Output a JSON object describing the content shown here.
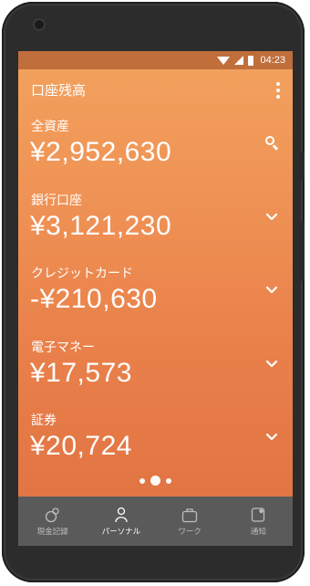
{
  "status_bar": {
    "time": "04:23"
  },
  "app_bar": {
    "title": "口座残高"
  },
  "accounts": [
    {
      "label": "全資産",
      "amount": "¥2,952,630",
      "action_icon": "search-icon"
    },
    {
      "label": "銀行口座",
      "amount": "¥3,121,230",
      "action_icon": "chevron-down-icon"
    },
    {
      "label": "クレジットカード",
      "amount": "-¥210,630",
      "action_icon": "chevron-down-icon"
    },
    {
      "label": "電子マネー",
      "amount": "¥17,573",
      "action_icon": "chevron-down-icon"
    },
    {
      "label": "証券",
      "amount": "¥20,724",
      "action_icon": "chevron-down-icon"
    }
  ],
  "pager": {
    "pages": 3,
    "current": 2
  },
  "bottom_nav": {
    "items": [
      {
        "label": "現金記録",
        "icon": "cash-record-icon",
        "active": false
      },
      {
        "label": "パーソナル",
        "icon": "person-icon",
        "active": true
      },
      {
        "label": "ワーク",
        "icon": "briefcase-icon",
        "active": false
      },
      {
        "label": "通知",
        "icon": "notification-icon",
        "active": false
      }
    ]
  },
  "colors": {
    "gradient_top": "#f3a25e",
    "gradient_bottom": "#e07343",
    "status_bar": "#c06e3c",
    "bottom_nav": "#5a5a5a"
  }
}
